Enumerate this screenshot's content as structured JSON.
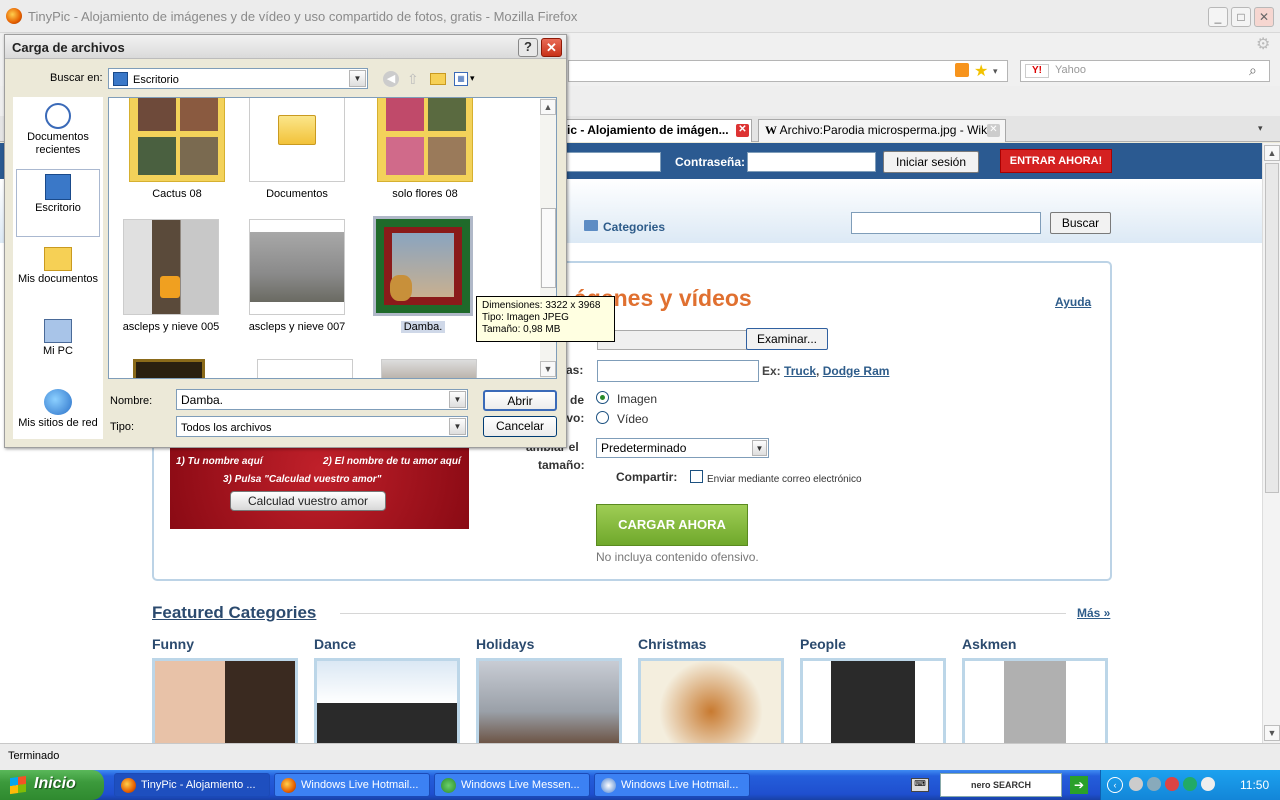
{
  "browser": {
    "title": "TinyPic - Alojamiento de imágenes y de vídeo y uso compartido de fotos, gratis - Mozilla Firefox",
    "search_placeholder": "Yahoo",
    "tabs": [
      {
        "label": "ic - Alojamiento de imágen..."
      },
      {
        "label": "Archivo:Parodia microsperma.jpg - Wiki..."
      }
    ],
    "status": "Terminado"
  },
  "page": {
    "login": {
      "password_label": "Contraseña:",
      "login_button": "Iniciar sesión",
      "enter_button": "ENTRAR AHORA!"
    },
    "nav": {
      "categories_label": "Categories",
      "search_button": "Buscar"
    },
    "upload": {
      "heading": "ágenes y vídeos",
      "help_link": "Ayuda",
      "browse_button": "Examinar...",
      "tags_label_partial": "as:",
      "tags_example_prefix": "Ex:",
      "tags_example_1": "Truck",
      "tags_example_sep": ",",
      "tags_example_2": "Dodge Ram",
      "type_label_partial_1": "de",
      "type_label_partial_2": "ivo:",
      "type_option_image": "Imagen",
      "type_option_video": "Vídeo",
      "resize_label_partial_1": "ambiar el",
      "resize_label_partial_2": "tamaño:",
      "resize_value": "Predeterminado",
      "share_label": "Compartir:",
      "share_option": "Enviar mediante correo electrónico",
      "upload_button": "CARGAR AHORA",
      "disclaimer": "No incluya contenido ofensivo."
    },
    "promo": {
      "line1a": "1) Tu nombre aquí",
      "line1b": "2) El nombre de tu amor aquí",
      "line2": "3) Pulsa \"Calculad vuestro amor\"",
      "button": "Calculad vuestro amor"
    },
    "featured": {
      "title": "Featured Categories",
      "more_link": "Más »",
      "categories": [
        "Funny",
        "Dance",
        "Holidays",
        "Christmas",
        "People",
        "Askmen"
      ]
    }
  },
  "dialog": {
    "title": "Carga de archivos",
    "look_in_label": "Buscar en:",
    "look_in_value": "Escritorio",
    "places": [
      "Documentos recientes",
      "Escritorio",
      "Mis documentos",
      "Mi PC",
      "Mis sitios de red"
    ],
    "files_row1": [
      "Cactus 08",
      "Documentos",
      "solo flores 08"
    ],
    "files_row2": [
      "asclеps y nieve 005",
      "ascleps y nieve 007",
      "Damba."
    ],
    "tooltip": {
      "dimensions": "Dimensiones: 3322 x 3968",
      "type": "Tipo: Imagen JPEG",
      "size": "Tamaño: 0,98 MB"
    },
    "name_label": "Nombre:",
    "name_value": "Damba.",
    "type_label": "Tipo:",
    "type_value": "Todos los archivos",
    "open_button": "Abrir",
    "cancel_button": "Cancelar"
  },
  "taskbar": {
    "start": "Inicio",
    "tasks": [
      "TinyPic - Alojamiento ...",
      "Windows Live Hotmail...",
      "Windows Live Messen...",
      "Windows Live Hotmail..."
    ],
    "tray_search": "nero SEARCH",
    "clock": "11:50"
  }
}
